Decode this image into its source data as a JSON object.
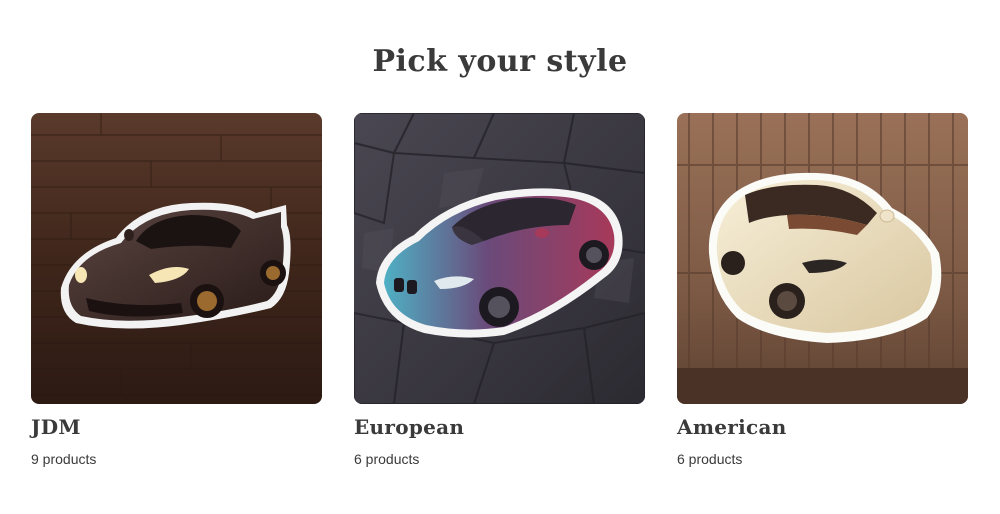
{
  "section": {
    "title": "Pick your style"
  },
  "collections": [
    {
      "name": "JDM",
      "count": "9 products",
      "image_icon": "dark-roadster-sticker-on-wood",
      "colors": {
        "bg": "#3f261b",
        "car": "#3d2a26"
      }
    },
    {
      "name": "European",
      "count": "6 products",
      "image_icon": "coupe-sticker-on-geometric-tiles",
      "colors": {
        "bg": "#3b3840",
        "car_top": "#4fb0c4",
        "car_body": "#a7395a"
      }
    },
    {
      "name": "American",
      "count": "6 products",
      "image_icon": "cream-sedan-sticker-on-wood-siding",
      "colors": {
        "bg": "#7d5a45",
        "car": "#efe4c9"
      }
    }
  ]
}
